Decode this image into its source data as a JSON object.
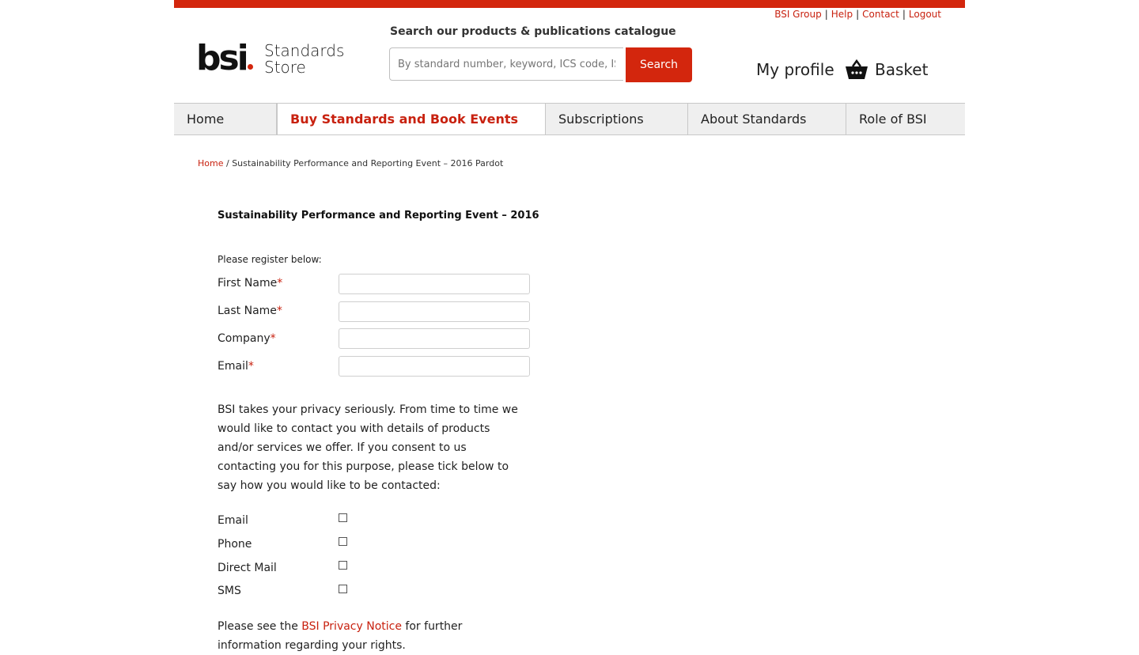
{
  "header": {
    "util_links": [
      "BSI Group",
      "Help",
      "Contact",
      "Logout"
    ],
    "logo_text": "bsi",
    "store_line1": "Standards",
    "store_line2": "Store",
    "search_label": "Search our products & publications catalogue",
    "search_placeholder": "By standard number, keyword, ICS code, IS",
    "search_button": "Search",
    "my_profile": "My profile",
    "basket": "Basket"
  },
  "nav": {
    "items": [
      "Home",
      "Buy Standards and Book Events",
      "Subscriptions",
      "About Standards",
      "Role of BSI"
    ],
    "active": "Buy Standards and Book Events"
  },
  "breadcrumb": {
    "home": "Home",
    "sep": "/",
    "current": "Sustainability Performance and Reporting Event – 2016 Pardot"
  },
  "form": {
    "title": "Sustainability Performance and Reporting Event – 2016",
    "intro": "Please register below:",
    "required_mark": "*",
    "fields": [
      {
        "label": "First Name",
        "value": ""
      },
      {
        "label": "Last Name",
        "value": ""
      },
      {
        "label": "Company",
        "value": ""
      },
      {
        "label": "Email",
        "value": ""
      }
    ],
    "privacy_text": "BSI takes your privacy seriously. From time to time we would like to contact you with details of products and/or services we offer. If you consent to us contacting you for this purpose, please tick below to say how you would like to be contacted:",
    "contact_options": [
      {
        "label": "Email",
        "checked": false
      },
      {
        "label": "Phone",
        "checked": false
      },
      {
        "label": "Direct Mail",
        "checked": false
      },
      {
        "label": "SMS",
        "checked": false
      }
    ],
    "notice_prefix": "Please see the ",
    "notice_link": "BSI Privacy Notice",
    "notice_suffix": " for further information regarding your rights."
  },
  "colors": {
    "brand_red": "#d3260d",
    "link_red": "#c8210f",
    "nav_bg": "#efefef"
  },
  "icons": {
    "basket": "basket-icon"
  }
}
